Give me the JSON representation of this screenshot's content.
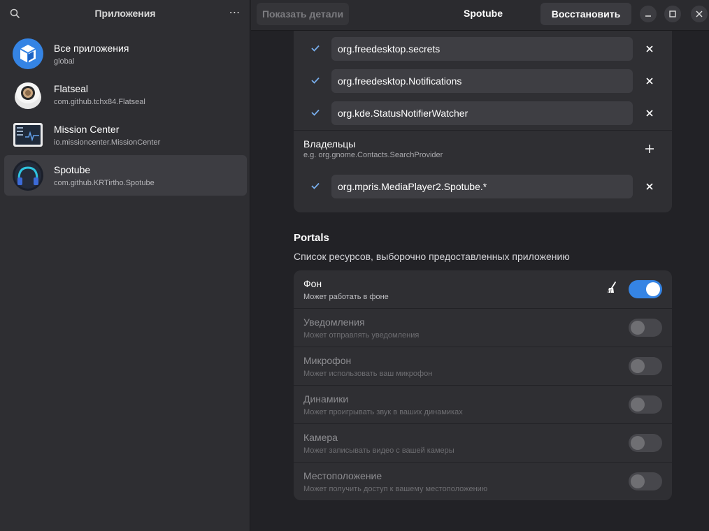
{
  "sidebar": {
    "title": "Приложения",
    "menu_glyph": "⋯",
    "apps": [
      {
        "name": "Все приложения",
        "id": "global",
        "icon": "all-apps-icon"
      },
      {
        "name": "Flatseal",
        "id": "com.github.tchx84.Flatseal",
        "icon": "flatseal-icon"
      },
      {
        "name": "Mission Center",
        "id": "io.missioncenter.MissionCenter",
        "icon": "mission-center-icon"
      },
      {
        "name": "Spotube",
        "id": "com.github.KRTirtho.Spotube",
        "icon": "spotube-icon",
        "selected": true
      }
    ]
  },
  "header": {
    "details_label": "Показать детали",
    "title": "Spotube",
    "restore_label": "Восстановить"
  },
  "session_bus": {
    "talks": [
      "org.freedesktop.secrets",
      "org.freedesktop.Notifications",
      "org.kde.StatusNotifierWatcher"
    ],
    "owners_title": "Владельцы",
    "owners_hint": "e.g. org.gnome.Contacts.SearchProvider",
    "owners": [
      "org.mpris.MediaPlayer2.Spotube.*"
    ]
  },
  "portals": {
    "title": "Portals",
    "description": "Список ресурсов, выборочно предоставленных приложению",
    "items": [
      {
        "title": "Фон",
        "subtitle": "Может работать в фоне",
        "enabled": true
      },
      {
        "title": "Уведомления",
        "subtitle": "Может отправлять уведомления",
        "enabled": false
      },
      {
        "title": "Микрофон",
        "subtitle": "Может использовать ваш микрофон",
        "enabled": false
      },
      {
        "title": "Динамики",
        "subtitle": "Может проигрывать звук в ваших динамиках",
        "enabled": false
      },
      {
        "title": "Камера",
        "subtitle": "Может записывать видео с вашей камеры",
        "enabled": false
      },
      {
        "title": "Местоположение",
        "subtitle": "Может получить доступ к вашему местоположению",
        "enabled": false
      }
    ]
  },
  "colors": {
    "accent": "#3584e4",
    "check": "#78aeed"
  }
}
